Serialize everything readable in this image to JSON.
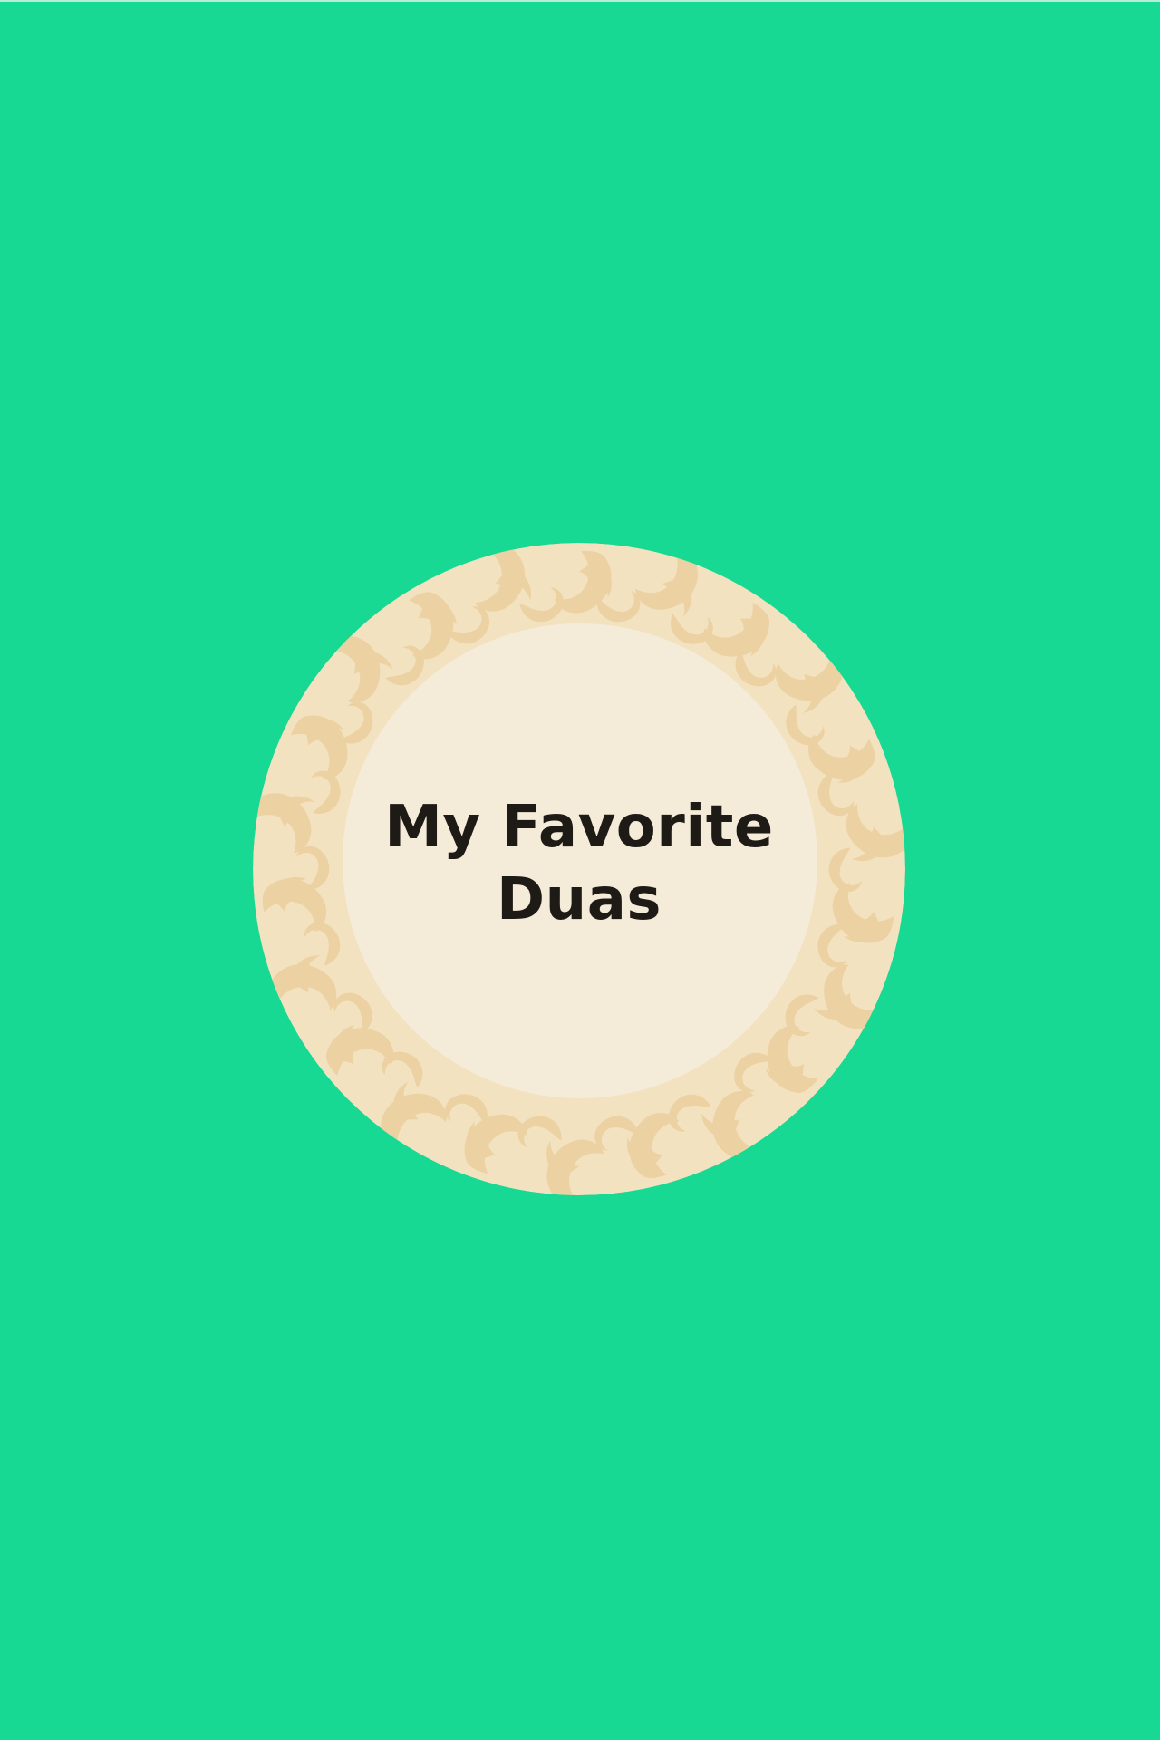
{
  "screen": {
    "background_color": "#17d993",
    "cover": {
      "title_line_1": "My Favorite",
      "title_line_2": "Duas",
      "ring_color": "#f3e2c0",
      "ornament_color": "#ecd1a2",
      "inner_color": "#f5ebd9",
      "text_color": "#1e1a16"
    }
  }
}
